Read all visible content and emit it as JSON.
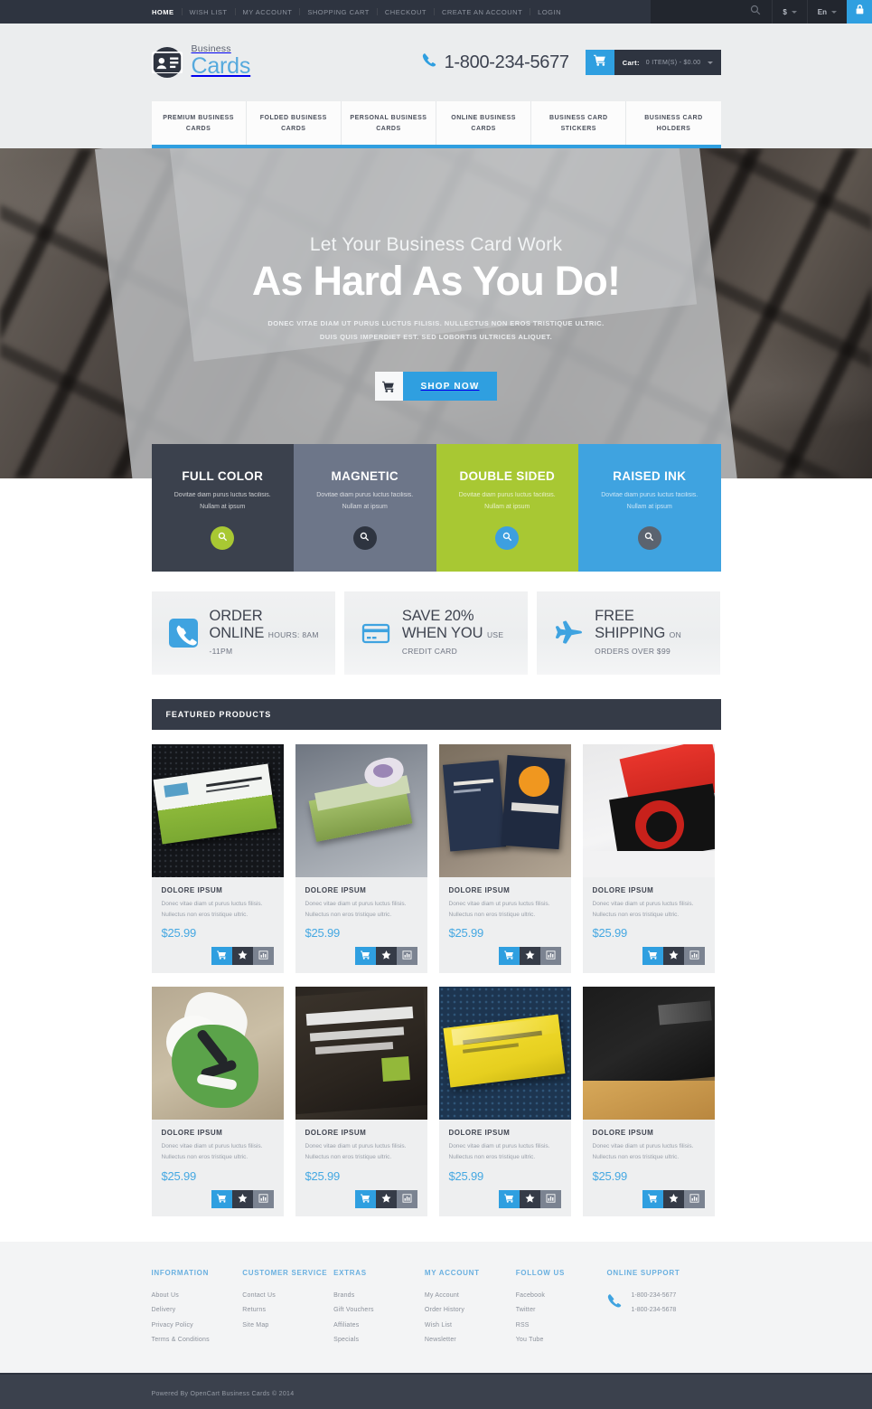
{
  "topbar": {
    "links": [
      {
        "label": "HOME",
        "active": true
      },
      {
        "label": "WISH LIST",
        "active": false
      },
      {
        "label": "MY ACCOUNT",
        "active": false
      },
      {
        "label": "SHOPPING CART",
        "active": false
      },
      {
        "label": "CHECKOUT",
        "active": false
      },
      {
        "label": "CREATE AN ACCOUNT",
        "active": false
      },
      {
        "label": "LOGIN",
        "active": false
      }
    ],
    "search_icon": "search-icon",
    "currency": "$",
    "language": "En",
    "lock_icon": "lock-icon"
  },
  "header": {
    "logo_top": "Business",
    "logo_bottom": "Cards",
    "logo_icon": "id-card-icon",
    "phone_icon": "phone-icon",
    "phone": "1-800-234-5677",
    "cart_icon": "shopping-cart-icon",
    "cart_label": "Cart:",
    "cart_value": "0 ITEM(S) - $0.00"
  },
  "nav": {
    "items": [
      "PREMIUM BUSINESS CARDS",
      "FOLDED BUSINESS CARDS",
      "PERSONAL BUSINESS CARDS",
      "ONLINE BUSINESS CARDS",
      "BUSINESS CARD STICKERS",
      "BUSINESS CARD HOLDERS"
    ]
  },
  "hero": {
    "subtitle": "Let Your Business Card Work",
    "title": "As Hard As You Do!",
    "desc_line1": "DONEC VITAE DIAM UT PURUS LUCTUS FILISIS. NULLECTUS NON EROS TRISTIQUE ULTRIC.",
    "desc_line2": "DUIS QUIS IMPERDIET EST. SED LOBORTIS ULTRICES ALIQUET.",
    "button_label": "SHOP NOW",
    "button_icon": "shopping-cart-icon"
  },
  "tiles": [
    {
      "title": "FULL COLOR",
      "desc": "Dovitae diam purus luctus facilisis. Nullam at ipsum",
      "bg": "#3b414d",
      "btn_bg": "#a8c833",
      "icon": "magnifier-icon"
    },
    {
      "title": "MAGNETIC",
      "desc": "Dovitae diam purus luctus facilisis. Nullam at ipsum",
      "bg": "#6d7689",
      "btn_bg": "#2e3440",
      "icon": "magnifier-icon"
    },
    {
      "title": "DOUBLE SIDED",
      "desc": "Dovitae diam purus luctus facilisis. Nullam at ipsum",
      "bg": "#a8c833",
      "btn_bg": "#3d9fe0",
      "icon": "magnifier-icon"
    },
    {
      "title": "RAISED INK",
      "desc": "Dovitae diam purus luctus facilisis. Nullam at ipsum",
      "bg": "#3fa3e0",
      "btn_bg": "#5b636f",
      "icon": "magnifier-icon"
    }
  ],
  "infos": [
    {
      "icon": "phone-square-icon",
      "title": "ORDER ONLINE",
      "sub": "HOURS: 8AM -11PM"
    },
    {
      "icon": "credit-card-icon",
      "title": "SAVE 20% WHEN YOU",
      "sub": "USE CREDIT CARD"
    },
    {
      "icon": "airplane-icon",
      "title": "FREE SHIPPING",
      "sub": "ON ORDERS OVER $99"
    }
  ],
  "featured": {
    "heading": "FEATURED PRODUCTS",
    "products": [
      {
        "name": "DOLORE IPSUM",
        "desc": "Donec vitae diam ut purus luctus filisis. Nullectus non eros tristique ultric.",
        "price": "$25.99",
        "img": "green-white-card-on-black-mesh"
      },
      {
        "name": "DOLORE IPSUM",
        "desc": "Donec vitae diam ut purus luctus filisis. Nullectus non eros tristique ultric.",
        "price": "$25.99",
        "img": "green-card-stack"
      },
      {
        "name": "DOLORE IPSUM",
        "desc": "Donec vitae diam ut purus luctus filisis. Nullectus non eros tristique ultric.",
        "price": "$25.99",
        "img": "sliced-orange-navy-cards"
      },
      {
        "name": "DOLORE IPSUM",
        "desc": "Donec vitae diam ut purus luctus filisis. Nullectus non eros tristique ultric.",
        "price": "$25.99",
        "img": "red-black-swirl-cards"
      },
      {
        "name": "DOLORE IPSUM",
        "desc": "Donec vitae diam ut purus luctus filisis. Nullectus non eros tristique ultric.",
        "price": "$25.99",
        "img": "green-die-cut-cards"
      },
      {
        "name": "DOLORE IPSUM",
        "desc": "Donec vitae diam ut purus luctus filisis. Nullectus non eros tristique ultric.",
        "price": "$25.99",
        "img": "dark-brown-embossed-card"
      },
      {
        "name": "DOLORE IPSUM",
        "desc": "Donec vitae diam ut purus luctus filisis. Nullectus non eros tristique ultric.",
        "price": "$25.99",
        "img": "yellow-card-on-blue-texture"
      },
      {
        "name": "DOLORE IPSUM",
        "desc": "Donec vitae diam ut purus luctus filisis. Nullectus non eros tristique ultric.",
        "price": "$25.99",
        "img": "black-folded-card-on-wood"
      }
    ],
    "action_labels": {
      "cart": "add-to-cart",
      "wishlist": "add-to-wishlist",
      "compare": "compare"
    }
  },
  "footer": {
    "columns": [
      {
        "heading": "INFORMATION",
        "links": [
          "About Us",
          "Delivery",
          "Privacy Policy",
          "Terms & Conditions"
        ]
      },
      {
        "heading": "CUSTOMER SERVICE",
        "links": [
          "Contact Us",
          "Returns",
          "Site Map"
        ]
      },
      {
        "heading": "EXTRAS",
        "links": [
          "Brands",
          "Gift Vouchers",
          "Affiliates",
          "Specials"
        ]
      },
      {
        "heading": "MY ACCOUNT",
        "links": [
          "My Account",
          "Order History",
          "Wish List",
          "Newsletter"
        ]
      },
      {
        "heading": "FOLLOW US",
        "links": [
          "Facebook",
          "Twitter",
          "RSS",
          "You Tube"
        ]
      }
    ],
    "support": {
      "heading": "ONLINE SUPPORT",
      "icon": "phone-icon",
      "numbers": [
        "1-800-234-5677",
        "1-800-234-5678"
      ]
    },
    "copyright": "Powered By OpenCart Business Cards © 2014"
  },
  "colors": {
    "accent": "#2f9fe0",
    "dark": "#2e3440",
    "green": "#a8c833",
    "price": "#45a8e2"
  }
}
